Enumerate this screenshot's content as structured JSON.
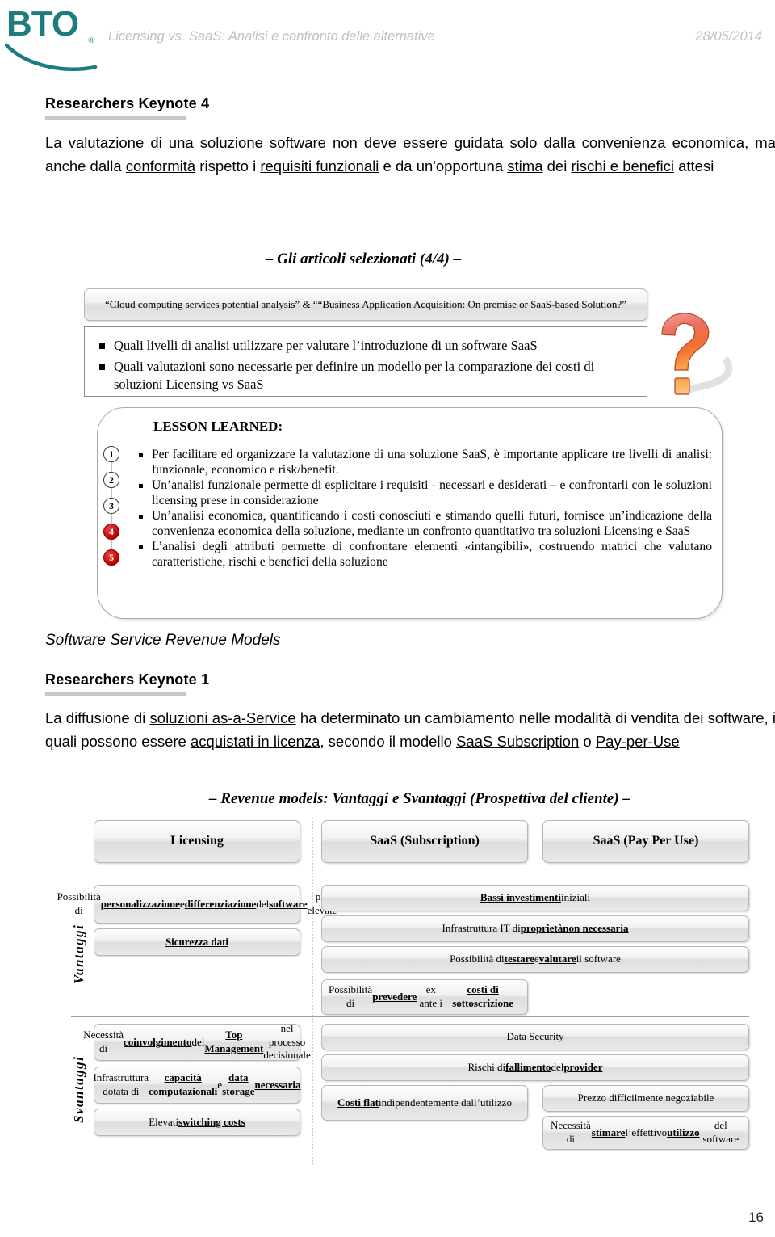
{
  "header": {
    "logo_text": "BTO",
    "logo_reg": "®",
    "title": "Licensing vs. SaaS: Analisi e confronto delle alternative",
    "date": "28/05/2014",
    "accent_color": "#1d7d7d",
    "title_color": "#bfbfbf"
  },
  "keynote4": {
    "heading": "Researchers Keynote 4",
    "paragraph_html": "La valutazione di una soluzione software non deve essere guidata solo dalla <u>convenienza economica</u>, ma anche dalla <u>conformità</u> rispetto i <u>requisiti funzionali</u> e da un'opportuna <u>stima</u> dei <u>rischi e benefici</u> attesi"
  },
  "articoli": {
    "slide_title": "– Gli articoli selezionati (4/4) –",
    "source_box": "“Cloud computing services potential analysis” & ““Business Application Acquisition: On premise or SaaS-based Solution?”",
    "questions": [
      "Quali livelli di analisi utilizzare per valutare l’introduzione di un software SaaS",
      "Quali valutazioni sono necessarie per definire un modello per la comparazione dei costi di soluzioni Licensing vs SaaS"
    ],
    "question_icon": "question-mark-3d"
  },
  "lesson_learned": {
    "title": "LESSON LEARNED:",
    "numbers": [
      "1",
      "2",
      "3",
      "4",
      "5"
    ],
    "number_styles": [
      "white",
      "white",
      "white",
      "red",
      "red"
    ],
    "items": [
      "Per facilitare ed organizzare la valutazione di una soluzione SaaS, è importante applicare tre livelli di analisi: funzionale, economico e risk/benefit.",
      "Un’analisi funzionale permette di esplicitare i requisiti - necessari e desiderati – e confrontarli con le soluzioni licensing prese in considerazione",
      "Un’analisi economica, quantificando i costi conosciuti e stimando quelli futuri, fornisce un’indicazione della convenienza economica della soluzione, mediante un confronto quantitativo tra soluzioni Licensing e SaaS",
      "L’analisi degli attributi permette di confrontare elementi «intangibili», costruendo matrici che valutano caratteristiche, rischi e benefici della soluzione"
    ]
  },
  "section2": {
    "title": "Software Service Revenue Models",
    "heading": "Researchers Keynote 1",
    "paragraph_html": "La diffusione di <u>soluzioni as-a-Service</u> ha determinato un cambiamento nelle modalità di vendita dei software, i quali possono essere <u>acquistati in licenza</u>, secondo il modello <u>SaaS Subscription</u> o <u>Pay-per-Use</u>"
  },
  "revenue_table": {
    "slide_title": "– Revenue models: Vantaggi e Svantaggi  (Prospettiva del cliente) –",
    "columns": [
      "Licensing",
      "SaaS (Subscription)",
      "SaaS (Pay Per Use)"
    ],
    "row_labels": [
      "Vantaggi",
      "Svantaggi"
    ],
    "vantaggi": {
      "licensing": [
        "Possibilità di <b><u>personalizzazione</u></b> e <b><u>differenziazione</u></b> del <b><u>software</u></b> più elevate",
        "<b><u>Sicurezza dati</u></b>"
      ],
      "saas_wide": [
        "<b><u>Bassi investimenti</u></b> iniziali",
        "Infrastruttura IT di <b><u>proprietà</u></b> <b><u>non necessaria</u></b>",
        "Possibilità di <b><u>testare</u></b> e <b><u>valutare</u></b> il software"
      ],
      "saas_subscription": [
        "Possibilità di <b><u>prevedere</u></b> ex ante i <b><u>costi di sottoscrizione</u></b>"
      ]
    },
    "svantaggi": {
      "licensing": [
        "Necessità di <b><u>coinvolgimento</u></b> del <b><u>Top Management</u></b> nel processo decisionale",
        "Infrastruttura dotata di  <b><u>capacità computazionali</u></b> e <b><u>data storage</u></b> <b><u>necessaria</u></b>",
        "Elevati <b><u>switching costs</u></b>"
      ],
      "saas_wide": [
        "Data Security",
        "Rischi di <b><u>fallimento</u></b> del <b><u>provider</u></b>"
      ],
      "saas_subscription": [
        "<b><u>Costi flat</u></b> indipendentemente dall’utilizzo"
      ],
      "saas_payperuse": [
        "Prezzo difficilmente negoziabile",
        "Necessità di <b><u>stimare</u></b> l’effettivo <b><u>utilizzo</u></b> del software"
      ]
    }
  },
  "footer": {
    "page_number": "16"
  }
}
